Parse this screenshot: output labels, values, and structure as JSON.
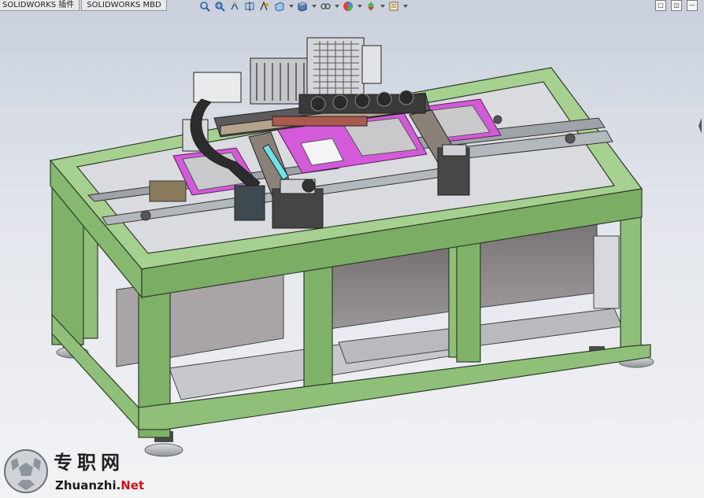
{
  "tabs": [
    {
      "label": "SOLIDWORKS 插件"
    },
    {
      "label": "SOLIDWORKS MBD"
    }
  ],
  "heads_up_toolbar": [
    {
      "icon": "zoom-to-fit-icon"
    },
    {
      "icon": "zoom-to-area-icon"
    },
    {
      "icon": "previous-view-icon"
    },
    {
      "icon": "section-view-icon"
    },
    {
      "icon": "dynamic-annotation-views-icon"
    },
    {
      "icon": "view-orientation-icon"
    },
    {
      "icon": "display-style-icon"
    },
    {
      "icon": "hide-show-items-icon"
    },
    {
      "icon": "edit-appearance-icon"
    },
    {
      "icon": "apply-scene-icon"
    },
    {
      "icon": "view-settings-icon"
    }
  ],
  "window_controls": [
    "restore-icon",
    "tile-icon",
    "minimize-icon"
  ],
  "colors": {
    "frame_green": "#8fbf78",
    "panel_gray": "#8a8688",
    "tray_magenta": "#d35ad8",
    "viewport_top": "#c9d0dc",
    "viewport_bottom": "#f2f3f5"
  },
  "watermark": {
    "cn": "专职网",
    "en_prefix": "Zhuanzhi.",
    "en_suffix": "Net"
  }
}
